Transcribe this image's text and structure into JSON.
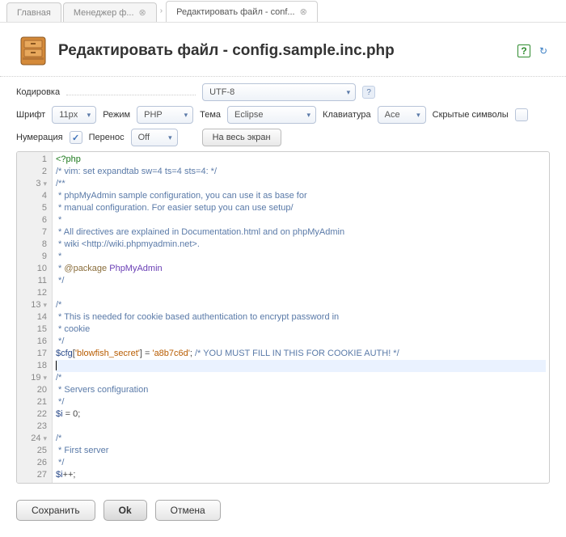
{
  "tabs": {
    "items": [
      {
        "label": "Главная",
        "closable": false,
        "active": false
      },
      {
        "label": "Менеджер ф...",
        "closable": true,
        "active": false
      },
      {
        "label": "Редактировать файл - conf...",
        "closable": true,
        "active": true
      }
    ]
  },
  "header": {
    "title": "Редактировать файл - config.sample.inc.php"
  },
  "toolbar": {
    "encoding": {
      "label": "Кодировка",
      "value": "UTF-8"
    },
    "font": {
      "label": "Шрифт",
      "value": "11px"
    },
    "mode": {
      "label": "Режим",
      "value": "PHP"
    },
    "theme": {
      "label": "Тема",
      "value": "Eclipse"
    },
    "keyboard": {
      "label": "Клавиатура",
      "value": "Ace"
    },
    "hidden_chars": {
      "label": "Скрытые символы",
      "checked": false
    },
    "numbering": {
      "label": "Нумерация",
      "checked": true
    },
    "wrap": {
      "label": "Перенос",
      "value": "Off"
    },
    "fullscreen": {
      "label": "На весь экран"
    }
  },
  "code": {
    "lines": [
      {
        "n": 1,
        "fold": false,
        "tokens": [
          {
            "t": "<?php",
            "c": "tag"
          }
        ]
      },
      {
        "n": 2,
        "fold": false,
        "tokens": [
          {
            "t": "/* vim: set expandtab sw=4 ts=4 sts=4: */",
            "c": "cmt"
          }
        ]
      },
      {
        "n": 3,
        "fold": true,
        "tokens": [
          {
            "t": "/**",
            "c": "cmt"
          }
        ]
      },
      {
        "n": 4,
        "fold": false,
        "tokens": [
          {
            "t": " * phpMyAdmin sample configuration, you can use it as base for",
            "c": "cmt"
          }
        ]
      },
      {
        "n": 5,
        "fold": false,
        "tokens": [
          {
            "t": " * manual configuration. For easier setup you can use setup/",
            "c": "cmt"
          }
        ]
      },
      {
        "n": 6,
        "fold": false,
        "tokens": [
          {
            "t": " *",
            "c": "cmt"
          }
        ]
      },
      {
        "n": 7,
        "fold": false,
        "tokens": [
          {
            "t": " * All directives are explained in Documentation.html and on phpMyAdmin",
            "c": "cmt"
          }
        ]
      },
      {
        "n": 8,
        "fold": false,
        "tokens": [
          {
            "t": " * wiki <http://wiki.phpmyadmin.net>.",
            "c": "cmt"
          }
        ]
      },
      {
        "n": 9,
        "fold": false,
        "tokens": [
          {
            "t": " *",
            "c": "cmt"
          }
        ]
      },
      {
        "n": 10,
        "fold": false,
        "tokens": [
          {
            "t": " * ",
            "c": "cmt"
          },
          {
            "t": "@package",
            "c": "ann"
          },
          {
            "t": " ",
            "c": "cmt"
          },
          {
            "t": "PhpMyAdmin",
            "c": "cls"
          }
        ]
      },
      {
        "n": 11,
        "fold": false,
        "tokens": [
          {
            "t": " */",
            "c": "cmt"
          }
        ]
      },
      {
        "n": 12,
        "fold": false,
        "tokens": []
      },
      {
        "n": 13,
        "fold": true,
        "tokens": [
          {
            "t": "/*",
            "c": "cmt"
          }
        ]
      },
      {
        "n": 14,
        "fold": false,
        "tokens": [
          {
            "t": " * This is needed for cookie based authentication to encrypt password in",
            "c": "cmt"
          }
        ]
      },
      {
        "n": 15,
        "fold": false,
        "tokens": [
          {
            "t": " * cookie",
            "c": "cmt"
          }
        ]
      },
      {
        "n": 16,
        "fold": false,
        "tokens": [
          {
            "t": " */",
            "c": "cmt"
          }
        ]
      },
      {
        "n": 17,
        "fold": false,
        "tokens": [
          {
            "t": "$cfg",
            "c": "var"
          },
          {
            "t": "[",
            "c": "op"
          },
          {
            "t": "'blowfish_secret'",
            "c": "str"
          },
          {
            "t": "] = ",
            "c": "op"
          },
          {
            "t": "'a8b7c6d'",
            "c": "str"
          },
          {
            "t": "; ",
            "c": "op"
          },
          {
            "t": "/* YOU MUST FILL IN THIS FOR COOKIE AUTH! */",
            "c": "cmt"
          }
        ]
      },
      {
        "n": 18,
        "fold": false,
        "active": true,
        "tokens": []
      },
      {
        "n": 19,
        "fold": true,
        "tokens": [
          {
            "t": "/*",
            "c": "cmt"
          }
        ]
      },
      {
        "n": 20,
        "fold": false,
        "tokens": [
          {
            "t": " * Servers configuration",
            "c": "cmt"
          }
        ]
      },
      {
        "n": 21,
        "fold": false,
        "tokens": [
          {
            "t": " */",
            "c": "cmt"
          }
        ]
      },
      {
        "n": 22,
        "fold": false,
        "tokens": [
          {
            "t": "$i",
            "c": "var"
          },
          {
            "t": " = ",
            "c": "op"
          },
          {
            "t": "0",
            "c": "op"
          },
          {
            "t": ";",
            "c": "op"
          }
        ]
      },
      {
        "n": 23,
        "fold": false,
        "tokens": []
      },
      {
        "n": 24,
        "fold": true,
        "tokens": [
          {
            "t": "/*",
            "c": "cmt"
          }
        ]
      },
      {
        "n": 25,
        "fold": false,
        "tokens": [
          {
            "t": " * First server",
            "c": "cmt"
          }
        ]
      },
      {
        "n": 26,
        "fold": false,
        "tokens": [
          {
            "t": " */",
            "c": "cmt"
          }
        ]
      },
      {
        "n": 27,
        "fold": false,
        "tokens": [
          {
            "t": "$i",
            "c": "var"
          },
          {
            "t": "++;",
            "c": "op"
          }
        ]
      }
    ]
  },
  "footer": {
    "save": "Сохранить",
    "ok": "Ok",
    "cancel": "Отмена"
  }
}
